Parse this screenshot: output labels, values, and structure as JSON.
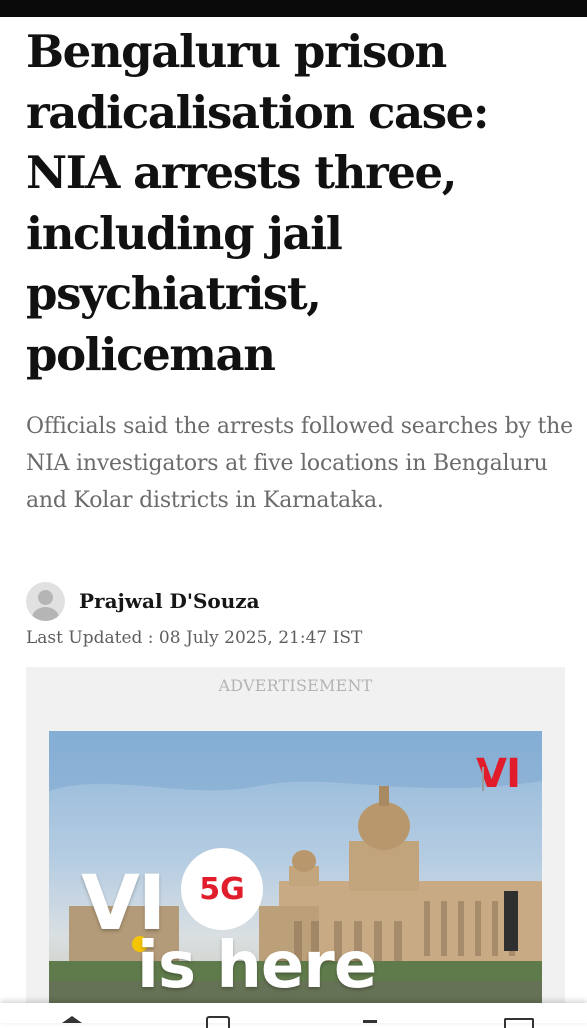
{
  "article": {
    "headline": "Bengaluru prison radicalisation case: NIA arrests three, including jail psychiatrist, policeman",
    "summary": "Officials said the arrests followed searches by the NIA investigators at five locations in Bengaluru and Kolar districts in Karnataka.",
    "author": "Prajwal D'Souza",
    "last_updated": "Last Updated : 08 July 2025, 21:47 IST"
  },
  "advertisement": {
    "label": "ADVERTISEMENT",
    "brand_logo": "VI",
    "headline_mark": "VI",
    "badge": "5G",
    "tagline": "is here"
  },
  "icons": {
    "avatar": "user-avatar-placeholder-icon",
    "nav": [
      "home-icon",
      "document-icon",
      "menu-icon",
      "window-icon"
    ]
  },
  "colors": {
    "status_bar": "#0a0a0a",
    "headline": "#111111",
    "summary": "#6b6b6b",
    "ad_background": "#f1f1f1",
    "brand_red": "#e11d2b",
    "brand_yellow": "#f5c400"
  }
}
